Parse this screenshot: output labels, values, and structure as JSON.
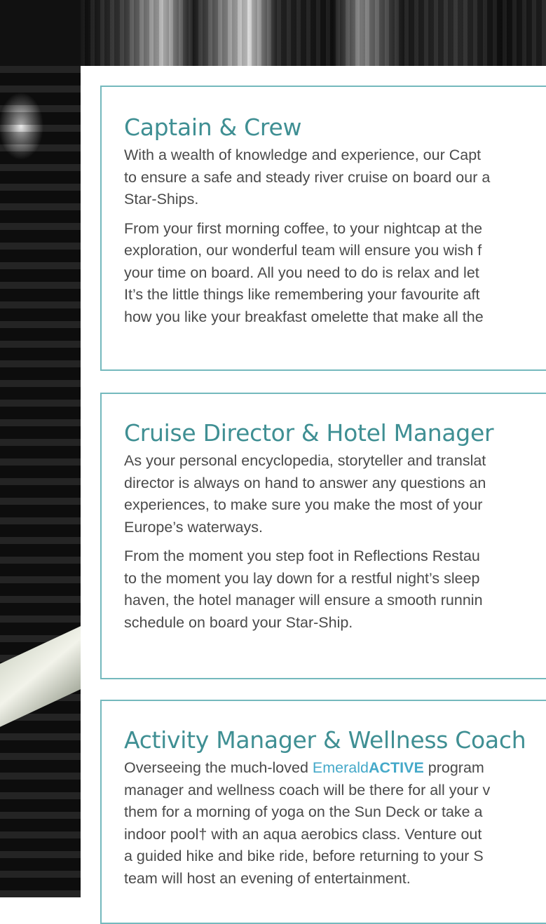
{
  "sections": [
    {
      "title": "Captain & Crew",
      "paragraphs": [
        "With a wealth of knowledge and experience, our Capt\nto ensure a safe and steady river cruise on board our a\nStar-Ships.",
        "From your first morning coffee, to your nightcap at the\nexploration, our wonderful team will ensure you wish f\nyour time on board. All you need to do is relax and let\nIt’s the little things like remembering your favourite aft\nhow you like your breakfast omelette that make all the"
      ]
    },
    {
      "title": "Cruise Director & Hotel Manager",
      "paragraphs": [
        "As your personal encyclopedia, storyteller and translat\ndirector is always on hand to answer any questions an\nexperiences, to make sure you make the most of your\nEurope’s waterways.",
        "From the moment you step foot in Reflections Restau\nto the moment you lay down for a restful night’s sleep\nhaven, the hotel manager will ensure a smooth runnin\nschedule on board your Star-Ship."
      ]
    },
    {
      "title": "Activity Manager & Wellness Coach",
      "p1_pre": "Overseeing the much-loved ",
      "brand_light": "Emerald",
      "brand_bold": "ACTIVE",
      "p1_post": " program",
      "p1_rest": "manager and wellness coach will be there for all your v\nthem for a morning of yoga on the Sun Deck or take a\nindoor pool† with an aqua aerobics class. Venture out\na guided hike and bike ride, before returning to your S\nteam will host an evening of entertainment."
    }
  ],
  "colors": {
    "heading": "#3f8f93",
    "border": "#74b9bd",
    "body_text": "#4a4a4a",
    "brand": "#45a9c9"
  }
}
